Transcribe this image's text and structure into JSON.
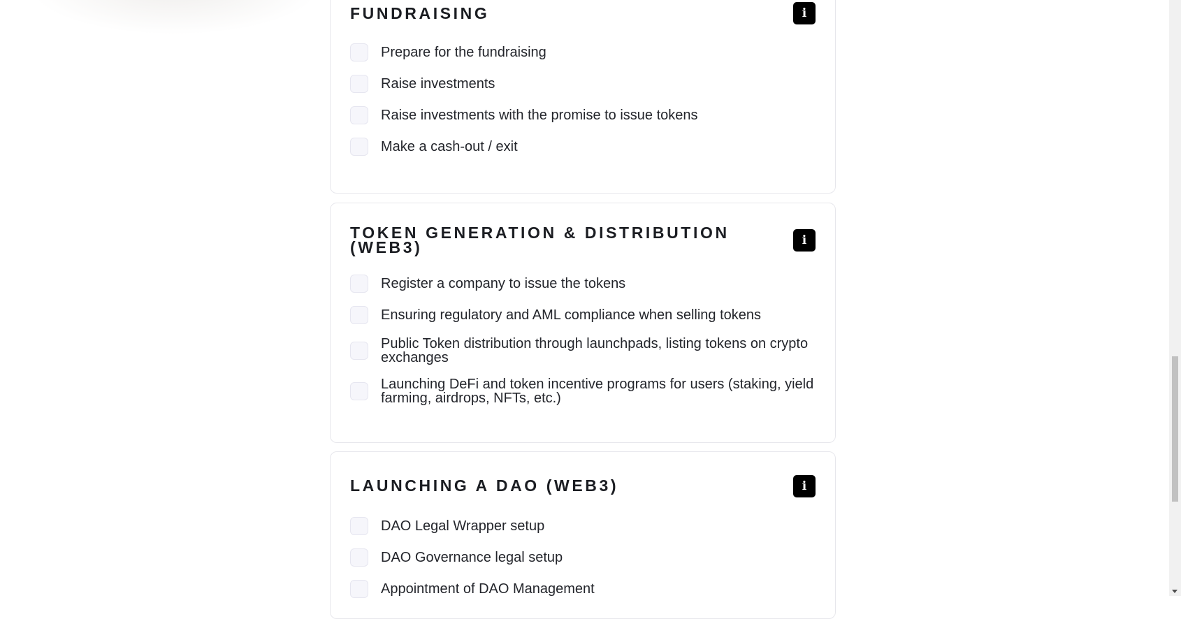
{
  "sections": [
    {
      "title": "FUNDRAISING",
      "info_icon": "info-icon",
      "items": [
        {
          "label": "Prepare for the fundraising",
          "checked": false
        },
        {
          "label": "Raise investments",
          "checked": false
        },
        {
          "label": "Raise investments with the promise to issue tokens",
          "checked": false
        },
        {
          "label": "Make a cash-out / exit",
          "checked": false
        }
      ]
    },
    {
      "title": "TOKEN GENERATION & DISTRIBUTION (WEB3)",
      "info_icon": "info-icon",
      "items": [
        {
          "label": "Register a company to issue the tokens",
          "checked": false
        },
        {
          "label": "Ensuring regulatory and AML compliance when selling tokens",
          "checked": false
        },
        {
          "label": "Public Token distribution through launchpads, listing tokens on crypto exchanges",
          "checked": false
        },
        {
          "label": "Launching DeFi and token incentive programs for users (staking, yield farming, airdrops, NFTs, etc.)",
          "checked": false
        }
      ]
    },
    {
      "title": "LAUNCHING A DAO (WEB3)",
      "info_icon": "info-icon",
      "items": [
        {
          "label": "DAO Legal Wrapper setup",
          "checked": false
        },
        {
          "label": "DAO Governance legal setup",
          "checked": false
        },
        {
          "label": "Appointment of DAO Management",
          "checked": false
        }
      ]
    }
  ],
  "colors": {
    "card_border": "#e7e7ec",
    "checkbox_fill": "#f6f6fb",
    "info_button": "#000000",
    "text": "#23252b"
  }
}
